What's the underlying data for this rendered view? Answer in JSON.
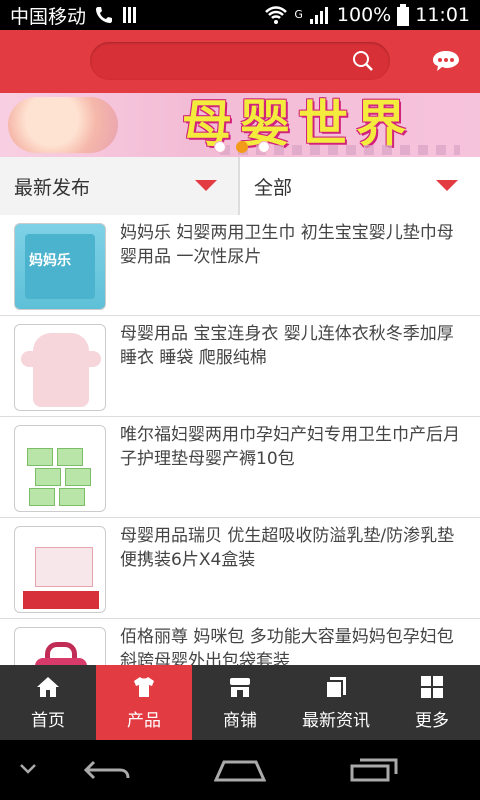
{
  "status_bar": {
    "carrier": "中国移动",
    "network": "G",
    "battery": "100%",
    "time": "11:01"
  },
  "header": {
    "search_placeholder": "",
    "icons": [
      "search-icon",
      "chat-icon"
    ]
  },
  "banner": {
    "title": "母婴世界",
    "slide_count": 3,
    "active_slide": 2
  },
  "filters": {
    "sort_label": "最新发布",
    "category_label": "全部"
  },
  "products": [
    {
      "title": "妈妈乐 妇婴两用卫生巾 初生宝宝婴儿垫巾母婴用品 一次性尿片",
      "thumb_text": "妈妈乐"
    },
    {
      "title": "母婴用品 宝宝连身衣 婴儿连体衣秋冬季加厚睡衣 睡袋 爬服纯棉"
    },
    {
      "title": "唯尔福妇婴两用巾孕妇产妇专用卫生巾产后月子护理垫母婴产褥10包"
    },
    {
      "title": "母婴用品瑞贝 优生超吸收防溢乳垫/防渗乳垫 便携装6片X4盒装"
    },
    {
      "title": "佰格丽尊 妈咪包 多功能大容量妈妈包孕妇包斜跨母婴外出包袋套装"
    }
  ],
  "tabbar": {
    "items": [
      {
        "label": "首页",
        "icon": "home-icon"
      },
      {
        "label": "产品",
        "icon": "shirt-icon"
      },
      {
        "label": "商铺",
        "icon": "shop-icon"
      },
      {
        "label": "最新资讯",
        "icon": "news-icon"
      },
      {
        "label": "更多",
        "icon": "grid-icon"
      }
    ],
    "active_index": 1
  },
  "colors": {
    "brand_red": "#e23b41",
    "tabbar_bg": "#333333"
  }
}
